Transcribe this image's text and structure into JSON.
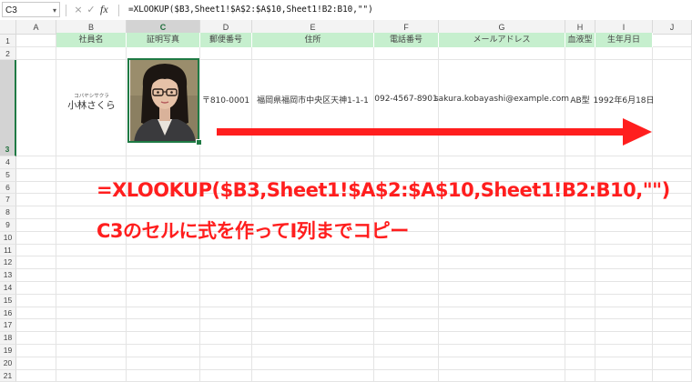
{
  "formula_bar": {
    "name_box": "C3",
    "cancel_icon": "×",
    "enter_icon": "✓",
    "fx_label": "fx",
    "formula": "=XLOOKUP($B3,Sheet1!$A$2:$A$10,Sheet1!B2:B10,\"\")"
  },
  "columns": [
    "A",
    "B",
    "C",
    "D",
    "E",
    "F",
    "G",
    "H",
    "I",
    "J"
  ],
  "selected_column": "C",
  "rows": [
    "1",
    "2",
    "3",
    "4",
    "5",
    "6",
    "7",
    "8",
    "9",
    "10",
    "11",
    "12",
    "13",
    "14",
    "15",
    "16",
    "17",
    "18",
    "19",
    "20",
    "21"
  ],
  "selected_row": "3",
  "table": {
    "headers": [
      "社員名",
      "証明写真",
      "郵便番号",
      "住所",
      "電話番号",
      "メールアドレス",
      "血液型",
      "生年月日"
    ],
    "header_fill": "#c6efce",
    "record": {
      "ruby": "コバヤシサクラ",
      "name": "小林さくら",
      "postal": "〒810-0001",
      "address": "福岡県福岡市中央区天神1-1-1",
      "phone": "092-4567-8901",
      "email": "sakura.kobayashi@example.com",
      "blood_type": "AB型",
      "birthdate": "1992年6月18日"
    }
  },
  "annotation": {
    "formula": "=XLOOKUP($B3,Sheet1!$A$2:$A$10,Sheet1!B2:B10,\"\")",
    "instruction": "C3のセルに式を作ってI列までコピー",
    "color": "#ff1e1e"
  },
  "colors": {
    "selection": "#1f7a44",
    "accent_arrow": "#ff1e1e"
  }
}
